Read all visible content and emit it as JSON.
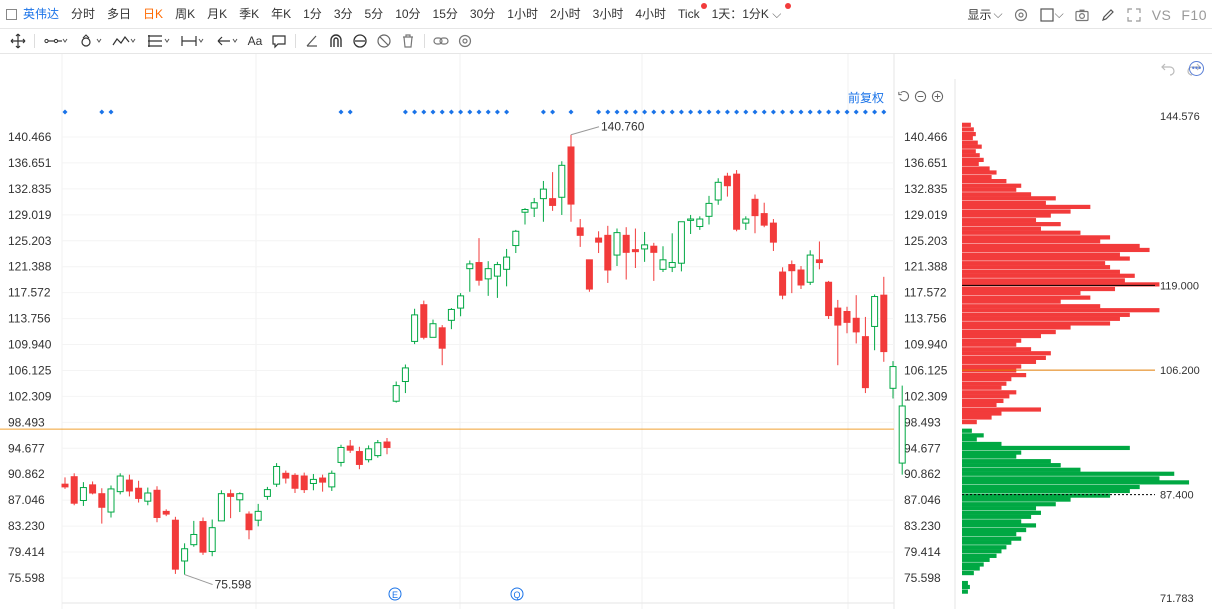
{
  "toolbar": {
    "stock_name": "英伟达",
    "periods": [
      "分时",
      "多日",
      "日K",
      "周K",
      "月K",
      "季K",
      "年K",
      "1分",
      "3分",
      "5分",
      "10分",
      "15分",
      "30分",
      "1小时",
      "2小时",
      "3小时",
      "4小时",
      "Tick"
    ],
    "active_period": "日K",
    "custom_period": "1天：1分K",
    "display_label": "显示",
    "vs_label": "VS",
    "f10_label": "F10"
  },
  "chart": {
    "adjust_label": "前复权",
    "high_label": "140.760",
    "low_label": "75.598",
    "y_ticks": [
      "140.466",
      "136.651",
      "132.835",
      "129.019",
      "125.203",
      "121.388",
      "117.572",
      "113.756",
      "109.940",
      "106.125",
      "102.309",
      "98.493",
      "94.677",
      "90.862",
      "87.046",
      "83.230",
      "79.414",
      "75.598"
    ],
    "markers": [
      "E",
      "Q"
    ],
    "colors": {
      "up": "#00a843",
      "down": "#f23b3b",
      "accent": "#1a73e8",
      "price_line": "#f0a030"
    }
  },
  "volume_profile": {
    "top_label": "144.576",
    "bottom_label": "71.783",
    "levels": [
      {
        "label": "119.000",
        "color": "#000000"
      },
      {
        "label": "106.200",
        "color": "#e07b00"
      },
      {
        "label": "87.400",
        "color": "#000000"
      }
    ]
  },
  "candles": [
    {
      "o": 89.4,
      "h": 90.4,
      "l": 88.7,
      "c": 89.0
    },
    {
      "o": 90.5,
      "h": 91.0,
      "l": 86.3,
      "c": 86.6
    },
    {
      "o": 87.0,
      "h": 89.7,
      "l": 86.2,
      "c": 88.9
    },
    {
      "o": 89.3,
      "h": 89.8,
      "l": 87.9,
      "c": 88.1
    },
    {
      "o": 88.0,
      "h": 88.8,
      "l": 83.6,
      "c": 86.0
    },
    {
      "o": 85.3,
      "h": 89.2,
      "l": 84.5,
      "c": 88.7
    },
    {
      "o": 88.3,
      "h": 91.0,
      "l": 87.9,
      "c": 90.6
    },
    {
      "o": 90.0,
      "h": 90.8,
      "l": 87.6,
      "c": 88.4
    },
    {
      "o": 88.8,
      "h": 89.9,
      "l": 86.7,
      "c": 87.3
    },
    {
      "o": 86.9,
      "h": 88.9,
      "l": 86.3,
      "c": 88.1
    },
    {
      "o": 88.5,
      "h": 89.1,
      "l": 83.8,
      "c": 84.5
    },
    {
      "o": 85.4,
      "h": 85.7,
      "l": 84.7,
      "c": 85.0
    },
    {
      "o": 84.1,
      "h": 84.6,
      "l": 76.2,
      "c": 76.9
    },
    {
      "o": 78.1,
      "h": 80.7,
      "l": 76.1,
      "c": 79.9
    },
    {
      "o": 80.5,
      "h": 84.0,
      "l": 80.2,
      "c": 82.0
    },
    {
      "o": 83.9,
      "h": 84.5,
      "l": 79.0,
      "c": 79.4
    },
    {
      "o": 79.5,
      "h": 84.2,
      "l": 78.8,
      "c": 83.0
    },
    {
      "o": 84.0,
      "h": 88.5,
      "l": 84.0,
      "c": 88.0
    },
    {
      "o": 88.0,
      "h": 88.6,
      "l": 84.4,
      "c": 87.6
    },
    {
      "o": 87.1,
      "h": 88.2,
      "l": 85.3,
      "c": 88.0
    },
    {
      "o": 85.0,
      "h": 85.4,
      "l": 81.3,
      "c": 82.7
    },
    {
      "o": 84.1,
      "h": 86.5,
      "l": 83.2,
      "c": 85.4
    },
    {
      "o": 87.6,
      "h": 89.0,
      "l": 87.1,
      "c": 88.6
    },
    {
      "o": 89.4,
      "h": 92.5,
      "l": 89.0,
      "c": 92.0
    },
    {
      "o": 91.0,
      "h": 91.4,
      "l": 89.5,
      "c": 90.3
    },
    {
      "o": 90.7,
      "h": 91.0,
      "l": 88.1,
      "c": 88.8
    },
    {
      "o": 90.6,
      "h": 91.1,
      "l": 88.1,
      "c": 88.6
    },
    {
      "o": 89.5,
      "h": 90.9,
      "l": 88.5,
      "c": 90.1
    },
    {
      "o": 90.3,
      "h": 90.8,
      "l": 88.3,
      "c": 89.7
    },
    {
      "o": 89.0,
      "h": 91.4,
      "l": 88.4,
      "c": 91.0
    },
    {
      "o": 92.6,
      "h": 95.2,
      "l": 92.0,
      "c": 94.8
    },
    {
      "o": 95.0,
      "h": 95.9,
      "l": 94.0,
      "c": 94.4
    },
    {
      "o": 94.2,
      "h": 94.9,
      "l": 91.6,
      "c": 92.3
    },
    {
      "o": 93.0,
      "h": 95.1,
      "l": 92.6,
      "c": 94.6
    },
    {
      "o": 93.6,
      "h": 95.9,
      "l": 93.3,
      "c": 95.5
    },
    {
      "o": 95.6,
      "h": 96.2,
      "l": 93.8,
      "c": 94.8
    },
    {
      "o": 101.6,
      "h": 104.5,
      "l": 101.4,
      "c": 103.9
    },
    {
      "o": 104.5,
      "h": 107.0,
      "l": 102.8,
      "c": 106.5
    },
    {
      "o": 110.4,
      "h": 115.2,
      "l": 110.0,
      "c": 114.3
    },
    {
      "o": 115.8,
      "h": 116.4,
      "l": 110.7,
      "c": 111.0
    },
    {
      "o": 111.0,
      "h": 113.6,
      "l": 111.0,
      "c": 113.0
    },
    {
      "o": 112.4,
      "h": 112.8,
      "l": 106.9,
      "c": 109.4
    },
    {
      "o": 113.5,
      "h": 115.3,
      "l": 112.2,
      "c": 115.1
    },
    {
      "o": 115.3,
      "h": 117.5,
      "l": 114.1,
      "c": 117.1
    },
    {
      "o": 121.1,
      "h": 122.3,
      "l": 117.7,
      "c": 121.8
    },
    {
      "o": 122.0,
      "h": 125.6,
      "l": 118.6,
      "c": 119.4
    },
    {
      "o": 119.6,
      "h": 122.2,
      "l": 117.1,
      "c": 121.1
    },
    {
      "o": 120.0,
      "h": 122.1,
      "l": 116.8,
      "c": 121.7
    },
    {
      "o": 121.0,
      "h": 124.0,
      "l": 118.5,
      "c": 122.8
    },
    {
      "o": 124.5,
      "h": 126.8,
      "l": 123.4,
      "c": 126.6
    },
    {
      "o": 129.4,
      "h": 130.0,
      "l": 127.6,
      "c": 129.8
    },
    {
      "o": 130.0,
      "h": 131.5,
      "l": 128.7,
      "c": 130.8
    },
    {
      "o": 131.4,
      "h": 134.0,
      "l": 128.0,
      "c": 132.8
    },
    {
      "o": 131.4,
      "h": 135.3,
      "l": 129.6,
      "c": 130.4
    },
    {
      "o": 131.6,
      "h": 136.9,
      "l": 129.0,
      "c": 136.3
    },
    {
      "o": 139.0,
      "h": 140.8,
      "l": 128.0,
      "c": 130.6
    },
    {
      "o": 127.1,
      "h": 128.4,
      "l": 124.3,
      "c": 126.0
    },
    {
      "o": 122.4,
      "h": 122.4,
      "l": 117.7,
      "c": 118.1
    },
    {
      "o": 125.6,
      "h": 126.6,
      "l": 123.4,
      "c": 125.0
    },
    {
      "o": 126.0,
      "h": 127.4,
      "l": 119.0,
      "c": 120.9
    },
    {
      "o": 123.1,
      "h": 127.0,
      "l": 121.5,
      "c": 126.4
    },
    {
      "o": 126.0,
      "h": 127.2,
      "l": 119.5,
      "c": 123.5
    },
    {
      "o": 123.9,
      "h": 127.0,
      "l": 121.2,
      "c": 123.6
    },
    {
      "o": 124.0,
      "h": 126.5,
      "l": 122.1,
      "c": 124.6
    },
    {
      "o": 124.4,
      "h": 124.9,
      "l": 119.3,
      "c": 123.5
    },
    {
      "o": 121.0,
      "h": 124.4,
      "l": 120.6,
      "c": 122.4
    },
    {
      "o": 121.3,
      "h": 126.3,
      "l": 120.6,
      "c": 122.0
    },
    {
      "o": 121.9,
      "h": 128.0,
      "l": 120.7,
      "c": 128.0
    },
    {
      "o": 128.2,
      "h": 129.0,
      "l": 126.2,
      "c": 128.4
    },
    {
      "o": 127.3,
      "h": 128.8,
      "l": 126.8,
      "c": 128.4
    },
    {
      "o": 128.8,
      "h": 131.8,
      "l": 127.6,
      "c": 130.7
    },
    {
      "o": 131.2,
      "h": 134.4,
      "l": 130.5,
      "c": 133.8
    },
    {
      "o": 134.7,
      "h": 135.2,
      "l": 131.7,
      "c": 133.3
    },
    {
      "o": 135.0,
      "h": 135.6,
      "l": 126.6,
      "c": 126.9
    },
    {
      "o": 127.8,
      "h": 128.8,
      "l": 126.8,
      "c": 128.4
    },
    {
      "o": 131.3,
      "h": 132.0,
      "l": 126.3,
      "c": 128.9
    },
    {
      "o": 129.2,
      "h": 130.8,
      "l": 127.2,
      "c": 127.5
    },
    {
      "o": 127.8,
      "h": 128.4,
      "l": 123.7,
      "c": 125.0
    },
    {
      "o": 120.6,
      "h": 121.3,
      "l": 116.6,
      "c": 117.2
    },
    {
      "o": 121.7,
      "h": 122.3,
      "l": 117.5,
      "c": 120.8
    },
    {
      "o": 120.9,
      "h": 121.5,
      "l": 118.1,
      "c": 118.7
    },
    {
      "o": 119.1,
      "h": 123.8,
      "l": 118.7,
      "c": 123.1
    },
    {
      "o": 122.4,
      "h": 125.1,
      "l": 121.0,
      "c": 122.0
    },
    {
      "o": 119.1,
      "h": 119.3,
      "l": 113.7,
      "c": 114.2
    },
    {
      "o": 115.3,
      "h": 116.5,
      "l": 106.9,
      "c": 112.8
    },
    {
      "o": 114.8,
      "h": 115.5,
      "l": 111.6,
      "c": 113.2
    },
    {
      "o": 113.8,
      "h": 117.2,
      "l": 110.1,
      "c": 111.8
    },
    {
      "o": 111.1,
      "h": 114.0,
      "l": 102.8,
      "c": 103.6
    },
    {
      "o": 112.6,
      "h": 117.3,
      "l": 109.1,
      "c": 117.0
    },
    {
      "o": 117.2,
      "h": 119.9,
      "l": 107.4,
      "c": 108.9
    },
    {
      "o": 103.5,
      "h": 107.5,
      "l": 102.0,
      "c": 106.7
    },
    {
      "o": 92.5,
      "h": 103.9,
      "l": 90.8,
      "c": 100.9
    }
  ],
  "volume_profile_bars": [
    {
      "p": 143.2,
      "v": 9
    },
    {
      "p": 142.5,
      "v": 12
    },
    {
      "p": 141.8,
      "v": 14
    },
    {
      "p": 141.2,
      "v": 11
    },
    {
      "p": 140.5,
      "v": 16
    },
    {
      "p": 139.9,
      "v": 20
    },
    {
      "p": 139.2,
      "v": 14
    },
    {
      "p": 138.6,
      "v": 18
    },
    {
      "p": 137.9,
      "v": 22
    },
    {
      "p": 137.3,
      "v": 17
    },
    {
      "p": 136.6,
      "v": 28
    },
    {
      "p": 136.0,
      "v": 35
    },
    {
      "p": 135.3,
      "v": 30
    },
    {
      "p": 134.7,
      "v": 45
    },
    {
      "p": 134.0,
      "v": 60
    },
    {
      "p": 133.4,
      "v": 55
    },
    {
      "p": 132.7,
      "v": 70
    },
    {
      "p": 132.1,
      "v": 95
    },
    {
      "p": 131.4,
      "v": 85
    },
    {
      "p": 130.8,
      "v": 130
    },
    {
      "p": 130.1,
      "v": 110
    },
    {
      "p": 129.5,
      "v": 90
    },
    {
      "p": 128.8,
      "v": 75
    },
    {
      "p": 128.2,
      "v": 100
    },
    {
      "p": 127.5,
      "v": 80
    },
    {
      "p": 126.9,
      "v": 120
    },
    {
      "p": 126.2,
      "v": 150
    },
    {
      "p": 125.6,
      "v": 140
    },
    {
      "p": 124.9,
      "v": 180
    },
    {
      "p": 124.3,
      "v": 190
    },
    {
      "p": 123.6,
      "v": 160
    },
    {
      "p": 123.0,
      "v": 170
    },
    {
      "p": 122.3,
      "v": 145
    },
    {
      "p": 121.7,
      "v": 150
    },
    {
      "p": 121.0,
      "v": 160
    },
    {
      "p": 120.4,
      "v": 175
    },
    {
      "p": 119.7,
      "v": 165
    },
    {
      "p": 119.1,
      "v": 200
    },
    {
      "p": 118.4,
      "v": 155
    },
    {
      "p": 117.8,
      "v": 120
    },
    {
      "p": 117.1,
      "v": 130
    },
    {
      "p": 116.5,
      "v": 100
    },
    {
      "p": 115.8,
      "v": 140
    },
    {
      "p": 115.2,
      "v": 200
    },
    {
      "p": 114.5,
      "v": 170
    },
    {
      "p": 113.9,
      "v": 160
    },
    {
      "p": 113.2,
      "v": 150
    },
    {
      "p": 112.6,
      "v": 110
    },
    {
      "p": 111.9,
      "v": 95
    },
    {
      "p": 111.3,
      "v": 80
    },
    {
      "p": 110.6,
      "v": 60
    },
    {
      "p": 110.0,
      "v": 55
    },
    {
      "p": 109.3,
      "v": 70
    },
    {
      "p": 108.7,
      "v": 90
    },
    {
      "p": 108.0,
      "v": 85
    },
    {
      "p": 107.4,
      "v": 75
    },
    {
      "p": 106.7,
      "v": 60
    },
    {
      "p": 106.1,
      "v": 55
    },
    {
      "p": 105.4,
      "v": 65
    },
    {
      "p": 104.8,
      "v": 50
    },
    {
      "p": 104.1,
      "v": 45
    },
    {
      "p": 103.5,
      "v": 40
    },
    {
      "p": 102.8,
      "v": 55
    },
    {
      "p": 102.2,
      "v": 48
    },
    {
      "p": 101.5,
      "v": 42
    },
    {
      "p": 100.9,
      "v": 35
    },
    {
      "p": 100.2,
      "v": 80
    },
    {
      "p": 99.6,
      "v": 40
    },
    {
      "p": 99.0,
      "v": 30
    },
    {
      "p": 98.3,
      "v": 15
    },
    {
      "p": 97.0,
      "v": 10
    },
    {
      "p": 96.3,
      "v": 22
    },
    {
      "p": 95.7,
      "v": 15
    },
    {
      "p": 95.0,
      "v": 40
    },
    {
      "p": 94.4,
      "v": 170
    },
    {
      "p": 93.7,
      "v": 60
    },
    {
      "p": 93.1,
      "v": 55
    },
    {
      "p": 92.4,
      "v": 90
    },
    {
      "p": 91.8,
      "v": 100
    },
    {
      "p": 91.1,
      "v": 120
    },
    {
      "p": 90.5,
      "v": 215
    },
    {
      "p": 89.8,
      "v": 200
    },
    {
      "p": 89.2,
      "v": 230
    },
    {
      "p": 88.5,
      "v": 180
    },
    {
      "p": 87.9,
      "v": 170
    },
    {
      "p": 87.2,
      "v": 150
    },
    {
      "p": 86.6,
      "v": 110
    },
    {
      "p": 85.9,
      "v": 95
    },
    {
      "p": 85.3,
      "v": 75
    },
    {
      "p": 84.6,
      "v": 80
    },
    {
      "p": 84.0,
      "v": 70
    },
    {
      "p": 83.3,
      "v": 60
    },
    {
      "p": 82.7,
      "v": 75
    },
    {
      "p": 82.0,
      "v": 65
    },
    {
      "p": 81.4,
      "v": 55
    },
    {
      "p": 80.7,
      "v": 60
    },
    {
      "p": 80.1,
      "v": 50
    },
    {
      "p": 79.4,
      "v": 45
    },
    {
      "p": 78.8,
      "v": 40
    },
    {
      "p": 78.1,
      "v": 35
    },
    {
      "p": 77.5,
      "v": 28
    },
    {
      "p": 76.8,
      "v": 22
    },
    {
      "p": 76.2,
      "v": 18
    },
    {
      "p": 75.5,
      "v": 12
    },
    {
      "p": 74.0,
      "v": 6
    },
    {
      "p": 73.4,
      "v": 8
    },
    {
      "p": 72.7,
      "v": 6
    }
  ]
}
